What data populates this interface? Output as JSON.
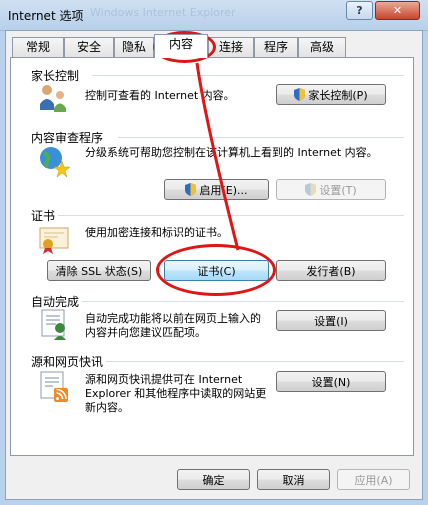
{
  "window": {
    "title": "Internet 选项",
    "blurred_title": "Windows Internet Explorer"
  },
  "titlebar_buttons": {
    "help": "?",
    "close": "✕"
  },
  "tabs": [
    "常规",
    "安全",
    "隐私",
    "内容",
    "连接",
    "程序",
    "高级"
  ],
  "active_tab": "内容",
  "parental": {
    "heading": "家长控制",
    "description": "控制可查看的 Internet 内容。",
    "button": "家长控制(P)"
  },
  "advisor": {
    "heading": "内容审查程序",
    "description": "分级系统可帮助您控制在该计算机上看到的 Internet 内容。",
    "enable_button": "启用(E)...",
    "settings_button": "设置(T)"
  },
  "certificates": {
    "heading": "证书",
    "description": "使用加密连接和标识的证书。",
    "clear_ssl_button": "清除 SSL 状态(S)",
    "certificates_button": "证书(C)",
    "publishers_button": "发行者(B)"
  },
  "autocomplete": {
    "heading": "自动完成",
    "description": "自动完成功能将以前在网页上输入的内容并向您建议匹配项。",
    "settings_button": "设置(I)"
  },
  "feeds": {
    "heading": "源和网页快讯",
    "description": "源和网页快讯提供可在 Internet Explorer 和其他程序中读取的网站更新内容。",
    "settings_button": "设置(N)"
  },
  "footer": {
    "ok": "确定",
    "cancel": "取消",
    "apply": "应用(A)"
  },
  "annotation_color": "#e01515"
}
